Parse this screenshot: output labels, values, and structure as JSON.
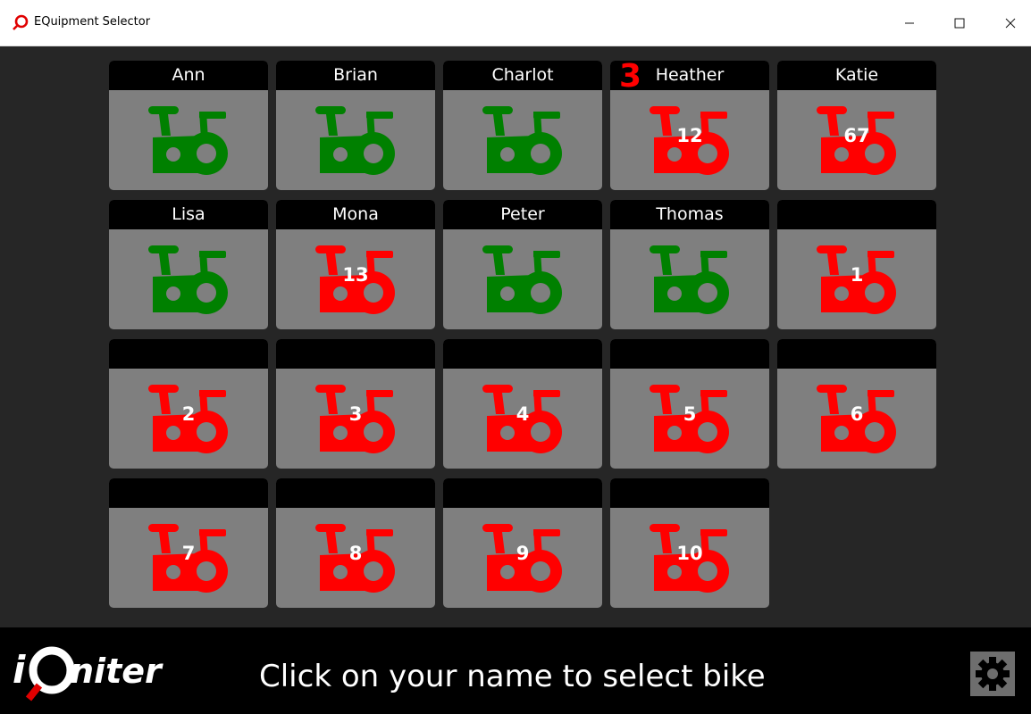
{
  "window": {
    "title": "EQuipment Selector",
    "minimize_label": "—",
    "maximize_label": "☐",
    "close_label": "✕"
  },
  "badge": {
    "text": "3"
  },
  "colors": {
    "available": "#008000",
    "taken": "#ff0000",
    "tile_bg": "#7f7f7f"
  },
  "tiles": [
    {
      "name": "Ann",
      "status": "available",
      "number": ""
    },
    {
      "name": "Brian",
      "status": "available",
      "number": ""
    },
    {
      "name": "Charlot",
      "status": "available",
      "number": ""
    },
    {
      "name": "Heather",
      "status": "taken",
      "number": "12"
    },
    {
      "name": "Katie",
      "status": "taken",
      "number": "67"
    },
    {
      "name": "Lisa",
      "status": "available",
      "number": ""
    },
    {
      "name": "Mona",
      "status": "taken",
      "number": "13"
    },
    {
      "name": "Peter",
      "status": "available",
      "number": ""
    },
    {
      "name": "Thomas",
      "status": "available",
      "number": ""
    },
    {
      "name": "",
      "status": "taken",
      "number": "1"
    },
    {
      "name": "",
      "status": "taken",
      "number": "2"
    },
    {
      "name": "",
      "status": "taken",
      "number": "3"
    },
    {
      "name": "",
      "status": "taken",
      "number": "4"
    },
    {
      "name": "",
      "status": "taken",
      "number": "5"
    },
    {
      "name": "",
      "status": "taken",
      "number": "6"
    },
    {
      "name": "",
      "status": "taken",
      "number": "7"
    },
    {
      "name": "",
      "status": "taken",
      "number": "8"
    },
    {
      "name": "",
      "status": "taken",
      "number": "9"
    },
    {
      "name": "",
      "status": "taken",
      "number": "10"
    }
  ],
  "footer": {
    "logo_text": "iQniter",
    "message": "Click on your name to select bike",
    "settings_icon": "gear-icon"
  }
}
